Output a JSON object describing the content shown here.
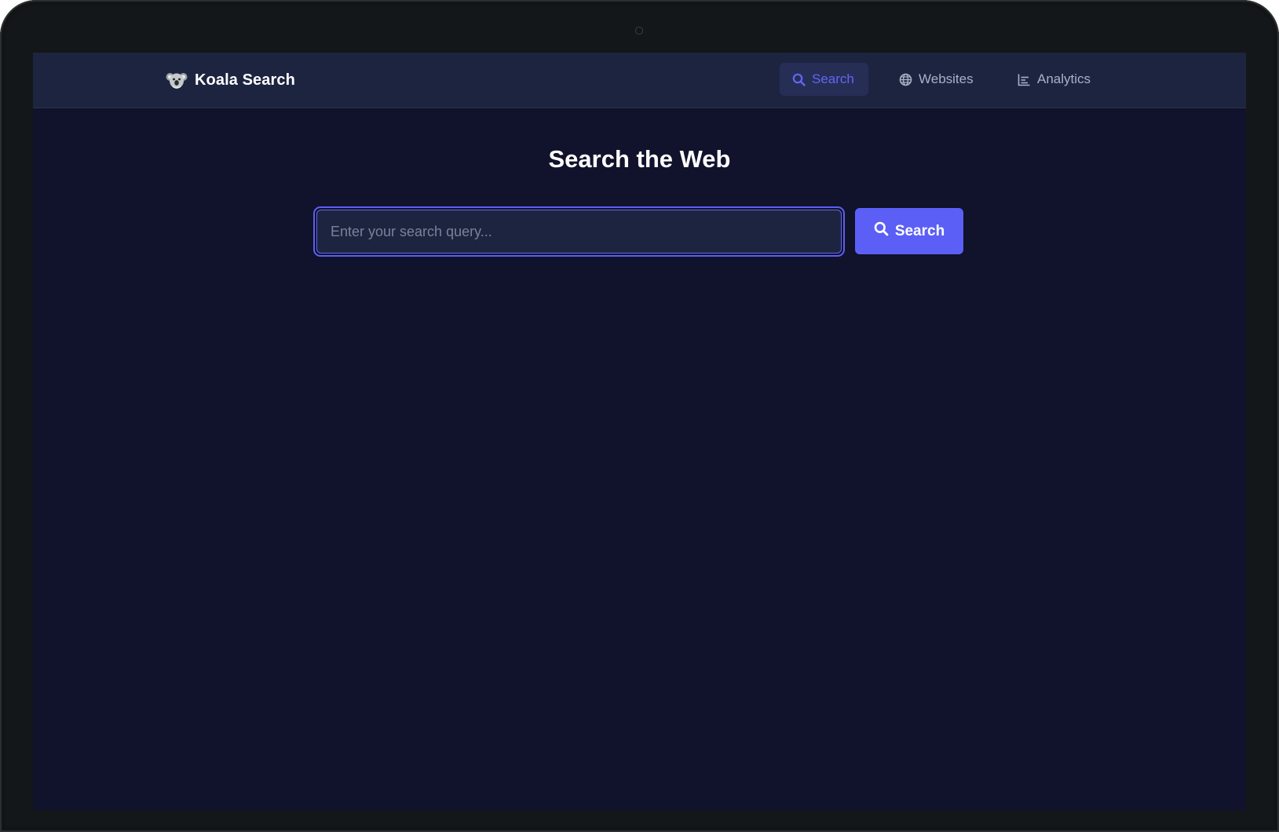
{
  "app": {
    "name": "Koala Search",
    "logo_icon": "koala-icon"
  },
  "nav": {
    "items": [
      {
        "label": "Search",
        "icon": "search-icon",
        "active": true
      },
      {
        "label": "Websites",
        "icon": "globe-icon",
        "active": false
      },
      {
        "label": "Analytics",
        "icon": "bar-chart-icon",
        "active": false
      }
    ]
  },
  "main": {
    "title": "Search the Web",
    "search_input": {
      "value": "",
      "placeholder": "Enter your search query..."
    },
    "search_button": {
      "label": "Search",
      "icon": "search-icon"
    }
  },
  "colors": {
    "accent": "#6366f1",
    "button": "#5b5ff6",
    "navbar_bg": "#1d2440",
    "page_bg": "#11122b",
    "nav_text": "#aab0c5"
  }
}
